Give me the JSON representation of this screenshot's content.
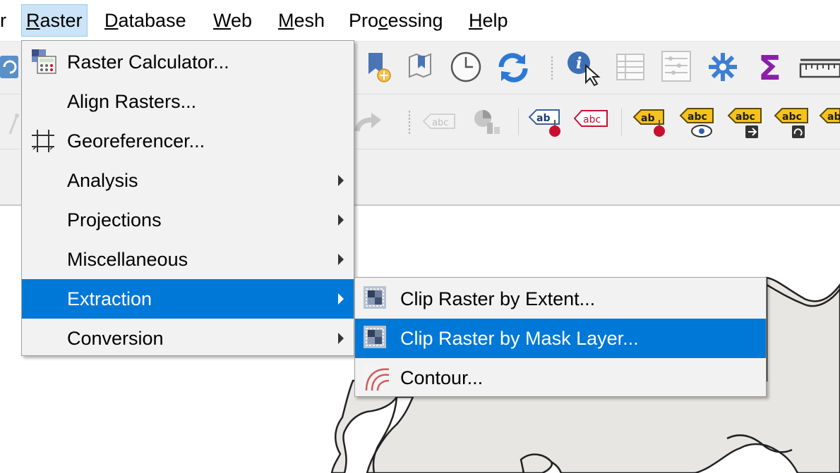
{
  "menubar": {
    "items": [
      {
        "label": "r"
      },
      {
        "label": "Raster",
        "accel": "R",
        "rest": "aster"
      },
      {
        "label": "Database",
        "accel": "D",
        "rest": "atabase"
      },
      {
        "label": "Web",
        "accel": "W",
        "rest": "eb"
      },
      {
        "label": "Mesh",
        "accel": "M",
        "rest": "esh"
      },
      {
        "label": "Processing",
        "pre": "Pro",
        "accel": "c",
        "rest": "essing"
      },
      {
        "label": "Help",
        "accel": "H",
        "rest": "elp"
      }
    ]
  },
  "raster_menu": {
    "items": [
      {
        "label": "Raster Calculator...",
        "icon": "raster-calculator-icon"
      },
      {
        "label": "Align Rasters..."
      },
      {
        "label": "Georeferencer...",
        "icon": "georeferencer-icon"
      },
      {
        "label": "Analysis",
        "submenu": true
      },
      {
        "label": "Projections",
        "submenu": true
      },
      {
        "label": "Miscellaneous",
        "submenu": true
      },
      {
        "label": "Extraction",
        "submenu": true,
        "highlighted": true
      },
      {
        "label": "Conversion",
        "submenu": true
      }
    ]
  },
  "extraction_submenu": {
    "items": [
      {
        "label": "Clip Raster by Extent...",
        "icon": "clip-raster-extent-icon"
      },
      {
        "label": "Clip Raster by Mask Layer...",
        "icon": "clip-raster-mask-icon",
        "highlighted": true
      },
      {
        "label": "Contour...",
        "icon": "contour-icon"
      }
    ]
  },
  "toolbar1": {
    "icons": [
      "refresh-partial-icon",
      "bookmark-new-icon",
      "bookmarks-icon",
      "temporal-clock-icon",
      "refresh-icon",
      "identify-features-icon",
      "attribute-table-icon",
      "field-calculator-icon",
      "toolbox-gear-icon",
      "statistics-sigma-icon",
      "measure-ruler-icon"
    ]
  },
  "toolbar2": {
    "icons": [
      "redo-arrow-icon",
      "label-abc-disabled-icon",
      "diagram-pin-icon",
      "label-pin-icon",
      "label-abc-red-icon",
      "label-move-pin-icon",
      "label-show-hide-icon",
      "label-change-icon",
      "label-rotate-icon",
      "label-partial-icon"
    ]
  },
  "colors": {
    "highlight": "#0078d7",
    "menu_bg": "#f2f2f2",
    "toolbar_bg": "#f0f0f0",
    "map_land": "#e8e6e3",
    "menubar_active": "#cce4f7"
  }
}
